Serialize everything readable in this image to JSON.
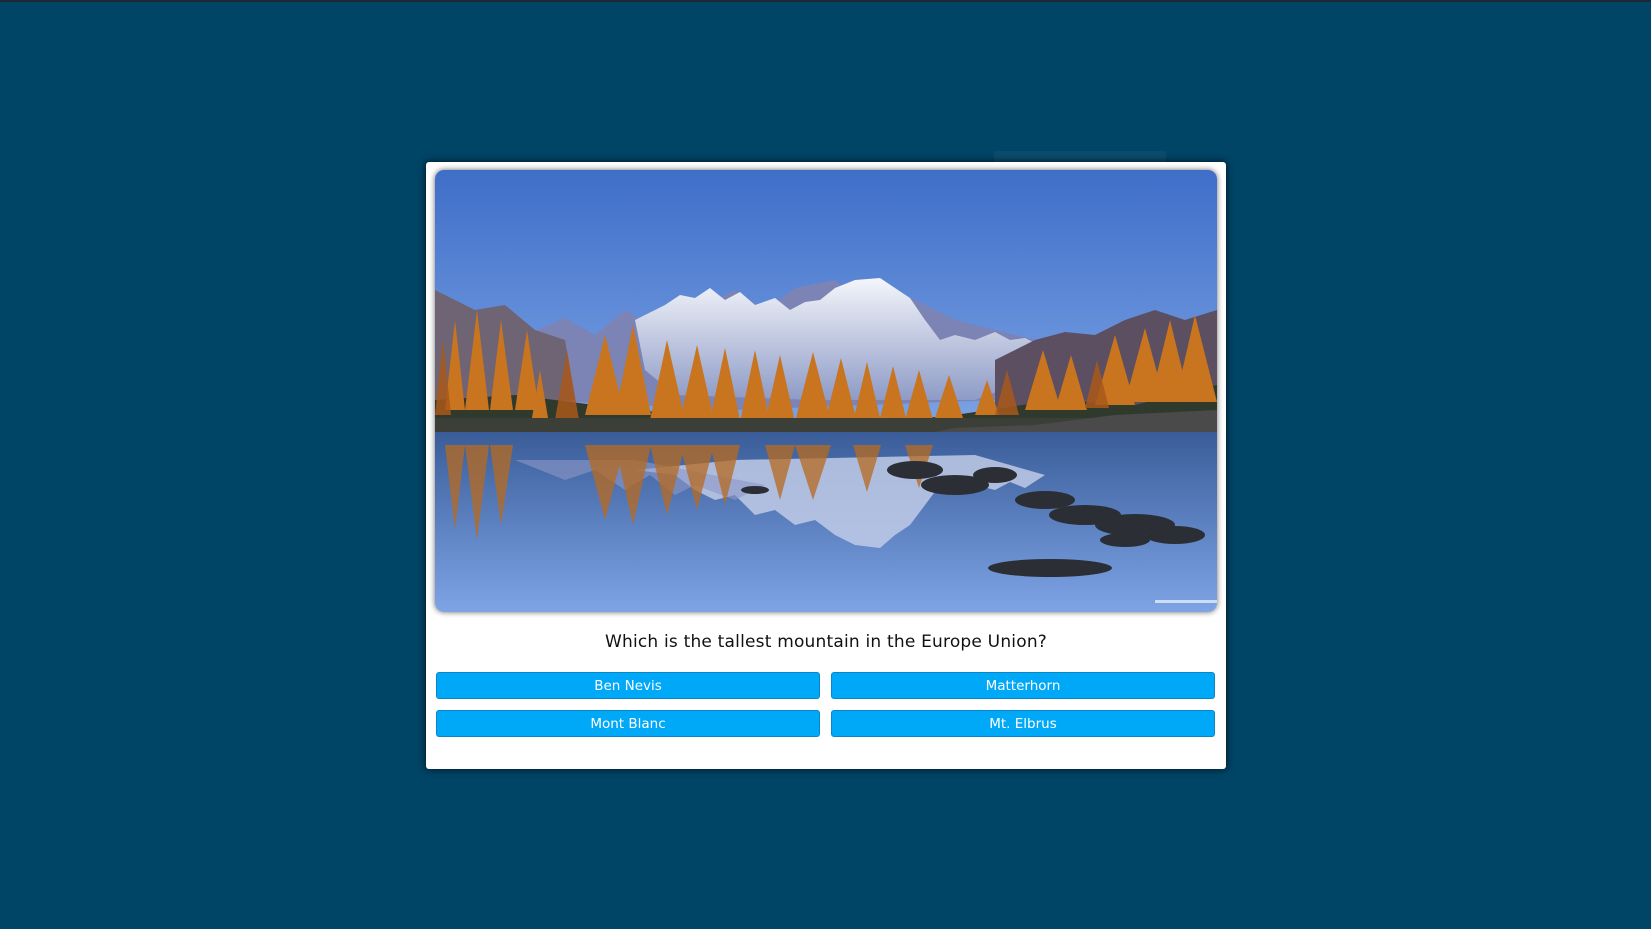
{
  "quiz": {
    "image_name": "mountain-lake-photo",
    "question": "Which is the tallest mountain in the Europe Union?",
    "answers": [
      "Ben Nevis",
      "Matterhorn",
      "Mont Blanc",
      "Mt. Elbrus"
    ]
  },
  "colors": {
    "background": "#004466",
    "card": "#ffffff",
    "button": "#00a8f8",
    "button_text": "#ffffff"
  }
}
